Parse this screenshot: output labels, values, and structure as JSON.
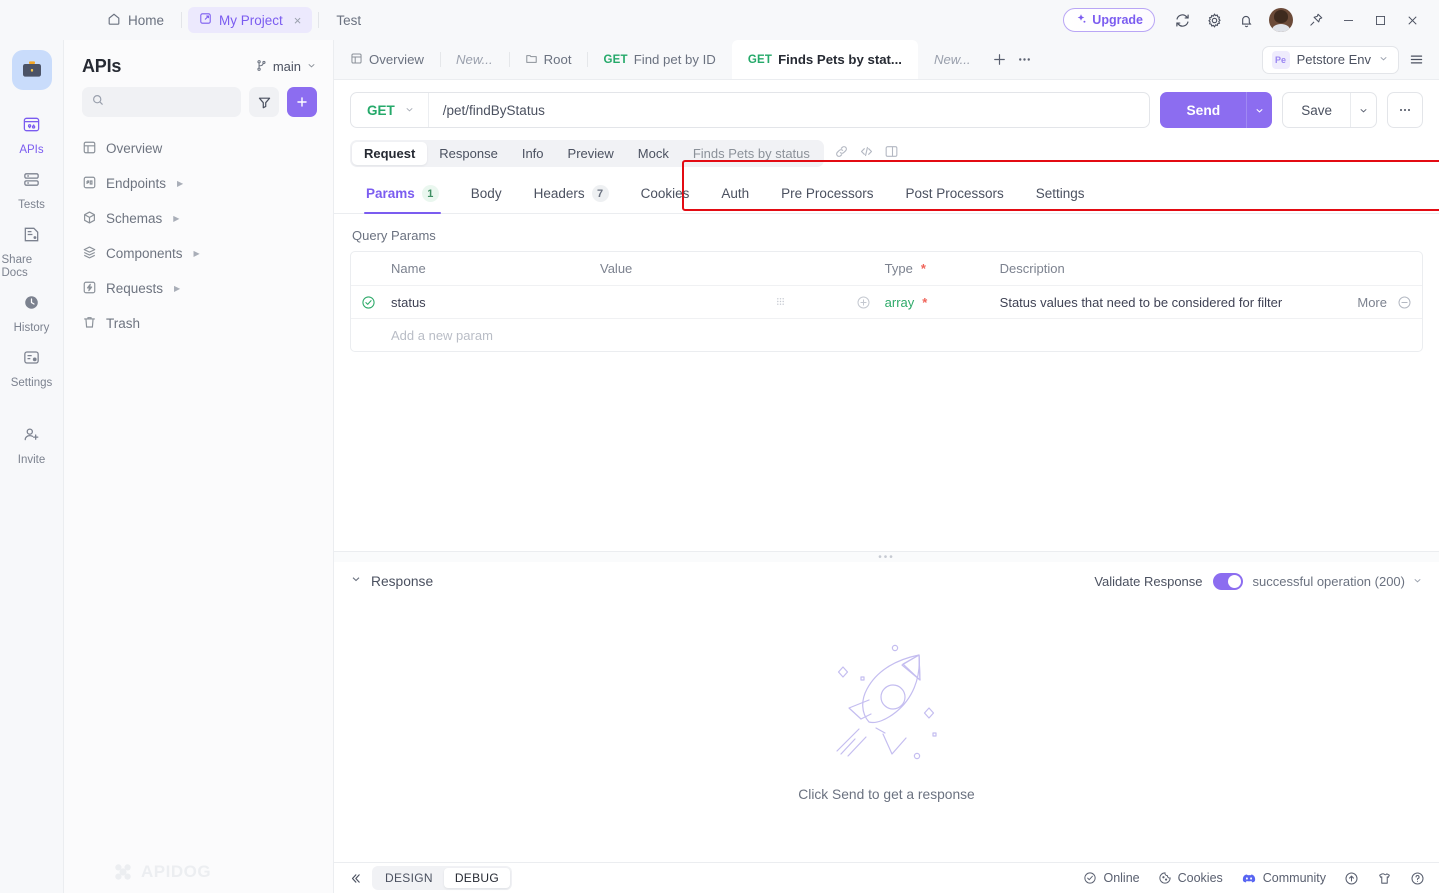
{
  "titlebar": {
    "home_label": "Home",
    "project_tab": "My Project",
    "project_close": "×",
    "test_tab": "Test",
    "upgrade_label": "Upgrade",
    "icons": {
      "home": "home-icon",
      "project": "project-icon",
      "sync": "sync-icon",
      "gear": "gear-icon",
      "bell": "bell-icon",
      "pin": "pin-icon",
      "minimize": "minimize-icon",
      "maximize": "maximize-icon",
      "close": "close-icon"
    }
  },
  "rail": {
    "items": [
      {
        "label": "APIs",
        "icon": "apis-icon",
        "active": true
      },
      {
        "label": "Tests",
        "icon": "tests-icon",
        "active": false
      },
      {
        "label": "Share Docs",
        "icon": "share-docs-icon",
        "active": false
      },
      {
        "label": "History",
        "icon": "history-icon",
        "active": false
      },
      {
        "label": "Settings",
        "icon": "settings-icon",
        "active": false
      },
      {
        "label": "Invite",
        "icon": "invite-icon",
        "active": false
      }
    ]
  },
  "sidebar": {
    "title": "APIs",
    "branch": "main",
    "search_placeholder": "",
    "filter_icon": "filter-icon",
    "add_label": "+",
    "tree": [
      {
        "label": "Overview",
        "icon": "overview-icon",
        "expandable": false
      },
      {
        "label": "Endpoints",
        "icon": "endpoints-icon",
        "expandable": true
      },
      {
        "label": "Schemas",
        "icon": "schemas-icon",
        "expandable": true
      },
      {
        "label": "Components",
        "icon": "components-icon",
        "expandable": true
      },
      {
        "label": "Requests",
        "icon": "requests-icon",
        "expandable": true
      },
      {
        "label": "Trash",
        "icon": "trash-icon",
        "expandable": false
      }
    ],
    "watermark": "APIDOG"
  },
  "tabbar": {
    "tabs": [
      {
        "label": "Overview",
        "icon": "overview-icon",
        "method": "",
        "active": false,
        "italic": false
      },
      {
        "label": "New...",
        "icon": "",
        "method": "",
        "active": false,
        "italic": true
      },
      {
        "label": "Root",
        "icon": "folder-icon",
        "method": "",
        "active": false,
        "italic": false
      },
      {
        "label": "Find pet by ID",
        "icon": "",
        "method": "GET",
        "active": false,
        "italic": false
      },
      {
        "label": "Finds Pets by stat...",
        "icon": "",
        "method": "GET",
        "active": true,
        "italic": false
      },
      {
        "label": "New...",
        "icon": "",
        "method": "",
        "active": false,
        "italic": true
      }
    ],
    "add_tab": "+",
    "more_tabs": "•••",
    "environment": "Petstore Env",
    "env_badge": "Pe",
    "menu_icon": "hamburger-icon"
  },
  "urlbar": {
    "method": "GET",
    "url": "/pet/findByStatus",
    "send_label": "Send",
    "save_label": "Save",
    "more_label": "•••",
    "highlight_color": "#e30b13"
  },
  "viewseg": {
    "items": [
      "Request",
      "Response",
      "Info",
      "Preview",
      "Mock"
    ],
    "active": "Request",
    "endpoint_name": "Finds Pets by status",
    "icons": [
      "link-icon",
      "code-icon",
      "layout-icon"
    ]
  },
  "param_tabs": {
    "items": [
      {
        "label": "Params",
        "badge": "1",
        "active": true
      },
      {
        "label": "Body",
        "badge": "",
        "active": false
      },
      {
        "label": "Headers",
        "badge": "7",
        "active": false
      },
      {
        "label": "Cookies",
        "badge": "",
        "active": false
      },
      {
        "label": "Auth",
        "badge": "",
        "active": false
      },
      {
        "label": "Pre Processors",
        "badge": "",
        "active": false
      },
      {
        "label": "Post Processors",
        "badge": "",
        "active": false
      },
      {
        "label": "Settings",
        "badge": "",
        "active": false
      }
    ]
  },
  "query_params": {
    "section_title": "Query Params",
    "headers": {
      "name": "Name",
      "value": "Value",
      "type": "Type",
      "type_required": "*",
      "description": "Description"
    },
    "rows": [
      {
        "checked": true,
        "name": "status",
        "value": "",
        "type": "array",
        "required": "*",
        "description": "Status values that need to be considered for filter",
        "more_label": "More"
      }
    ],
    "add_row_placeholder": "Add a new param"
  },
  "response": {
    "title": "Response",
    "validate_label": "Validate Response",
    "validate_on": true,
    "status_option": "successful operation (200)",
    "empty_hint": "Click Send to get a response",
    "illustration": "rocket-illustration"
  },
  "statusbar": {
    "collapse_icon": "collapse-left-icon",
    "modes": [
      {
        "label": "DESIGN",
        "active": false
      },
      {
        "label": "DEBUG",
        "active": true
      }
    ],
    "right_items": [
      {
        "label": "Online",
        "icon": "online-icon"
      },
      {
        "label": "Cookies",
        "icon": "cookie-icon"
      },
      {
        "label": "Community",
        "icon": "discord-icon"
      }
    ],
    "right_icons": [
      "upload-icon",
      "shirt-icon",
      "help-icon"
    ]
  },
  "colors": {
    "accent": "#8c6df0",
    "method_get": "#25a96a",
    "required": "#f0645a",
    "highlight": "#e30b13"
  }
}
